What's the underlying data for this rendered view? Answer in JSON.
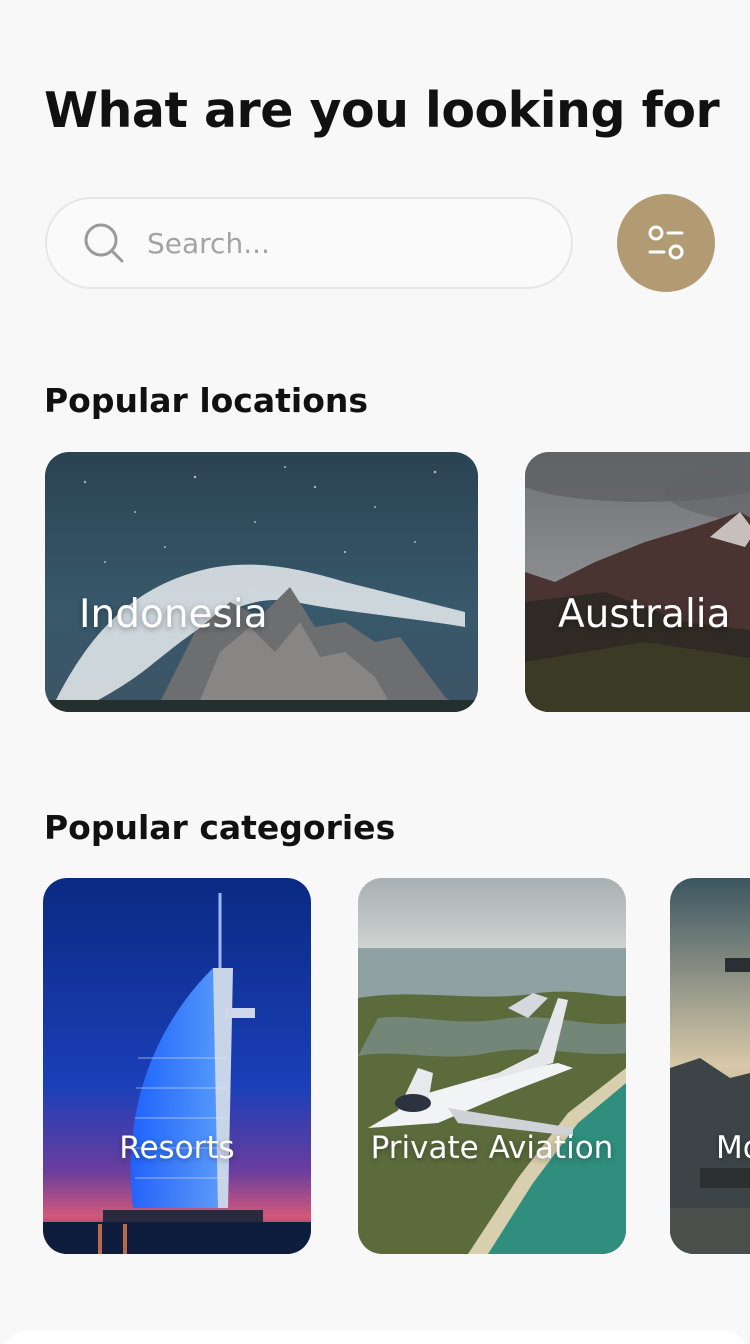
{
  "header": {
    "title": "What are you looking for"
  },
  "search": {
    "placeholder": "Search..."
  },
  "sections": {
    "locations_title": "Popular locations",
    "categories_title": "Popular categories"
  },
  "locations": [
    {
      "label": "Indonesia"
    },
    {
      "label": "Australia"
    }
  ],
  "categories": [
    {
      "label": "Resorts"
    },
    {
      "label": "Private Aviation"
    },
    {
      "label": "Mo"
    }
  ],
  "colors": {
    "accent": "#b29a73",
    "background": "#f8f8f8",
    "title_text": "#111111"
  },
  "icons": {
    "search": "search-icon",
    "filter": "filter-sliders-icon"
  }
}
